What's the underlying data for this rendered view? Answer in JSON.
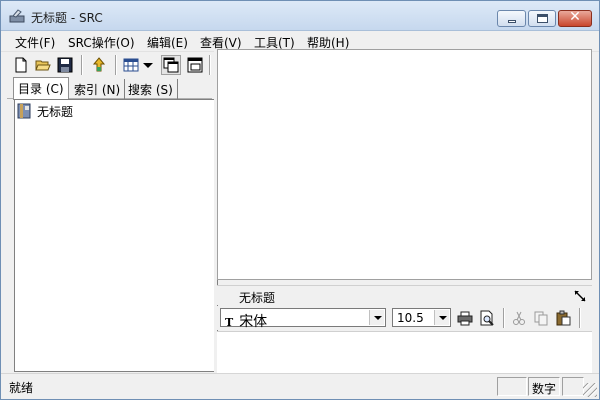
{
  "window": {
    "title": "无标题 - SRC"
  },
  "menu": {
    "items": [
      {
        "label": "文件(F)"
      },
      {
        "label": "SRC操作(O)"
      },
      {
        "label": "编辑(E)"
      },
      {
        "label": "查看(V)"
      },
      {
        "label": "工具(T)"
      },
      {
        "label": "帮助(H)"
      }
    ]
  },
  "toolbar": {
    "icons": [
      "new-document-icon",
      "open-folder-icon",
      "save-icon",
      "upload-icon",
      "grid-view-icon",
      "dropdown-arrow-icon",
      "window-tile-icon",
      "window-cascade-icon",
      "new-folder-icon",
      "compile-icon",
      "print-preview-icon",
      "export-icon",
      "disabled-tool-icon",
      "disabled-settings-icon",
      "help-icon"
    ]
  },
  "left_pane": {
    "tabs": [
      {
        "label": "目录 (C)"
      },
      {
        "label": "索引 (N)"
      },
      {
        "label": "搜索 (S)"
      }
    ],
    "tree_items": [
      {
        "label": "无标题"
      }
    ]
  },
  "editor": {
    "title": "无标题",
    "font_name": "宋体",
    "font_size": "10.5",
    "font_icon_text": "T"
  },
  "statusbar": {
    "status": "就绪",
    "cell1": "",
    "cell2": "数字",
    "cell3": ""
  },
  "colors": {
    "titlebar_top": "#dde9f7",
    "titlebar_bottom": "#c6d8ee",
    "close_button": "#c9462c",
    "window_bg": "#f0f0f0",
    "help_blue": "#2b61c5"
  }
}
